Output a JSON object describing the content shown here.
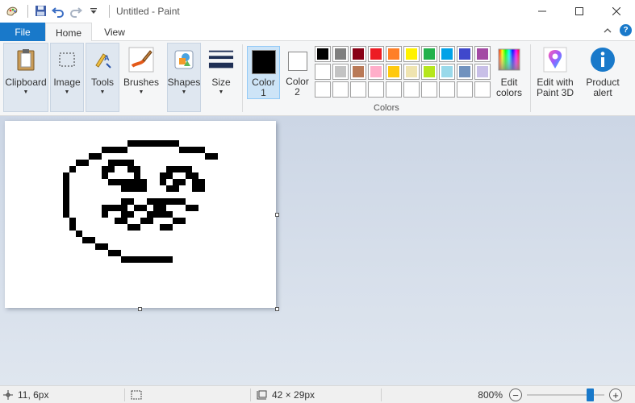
{
  "window": {
    "title": "Untitled - Paint"
  },
  "tabs": {
    "file": "File",
    "home": "Home",
    "view": "View"
  },
  "ribbon": {
    "clipboard": "Clipboard",
    "image": "Image",
    "tools": "Tools",
    "brushes": "Brushes",
    "shapes": "Shapes",
    "size": "Size",
    "color1": "Color\n1",
    "color2": "Color\n2",
    "edit_colors": "Edit\ncolors",
    "edit_paint3d": "Edit with\nPaint 3D",
    "product_alert": "Product\nalert",
    "colors_group": "Colors"
  },
  "colors": {
    "color1": "#000000",
    "color2": "#ffffff",
    "palette_row1": [
      "#000000",
      "#7f7f7f",
      "#880015",
      "#ed1c24",
      "#ff7f27",
      "#fff200",
      "#22b14c",
      "#00a2e8",
      "#3f48cc",
      "#a349a4"
    ],
    "palette_row2": [
      "#ffffff",
      "#c3c3c3",
      "#b97a57",
      "#ffaec9",
      "#ffc90e",
      "#efe4b0",
      "#b5e61d",
      "#99d9ea",
      "#7092be",
      "#c8bfe7"
    ],
    "palette_row3": [
      "#ffffff",
      "#ffffff",
      "#ffffff",
      "#ffffff",
      "#ffffff",
      "#ffffff",
      "#ffffff",
      "#ffffff",
      "#ffffff",
      "#ffffff"
    ],
    "accent": "#1979ca"
  },
  "status": {
    "cursor_pos": "11, 6px",
    "image_size": "42 × 29px",
    "zoom": "800%",
    "zoom_fraction": 0.85
  },
  "canvas": {
    "pixel_art_rows": [
      "..................................",
      "..................................",
      "..................................",
      "...................XXXXXXXX.......",
      "...............XXXX........XXXX...",
      ".............XX................XX.",
      "...........XX...XXXX..............",
      "..........X....XX..XX....XXXX.....",
      ".........X.....X....X...XX..XX....",
      ".........X......XXXXXX..X.XX.XX...",
      ".........X........XXXX...XX..XX...",
      ".........X.......................",
      ".........X........XX..XXXXXX.....",
      ".........X.....XXXX.XX.XX...XX...",
      ".........X.....X..XX..XXXX.......",
      "..........X......XX..XX...XX.....",
      "..........X........XX...XX.......",
      "...........X.....................",
      "............XX...................",
      "..............XX.................",
      "................XX...............",
      "..................XXXXXXXX.......",
      "..................................",
      "..................................",
      "..................................",
      "..................................",
      "..................................",
      "..................................",
      ".................................."
    ]
  }
}
